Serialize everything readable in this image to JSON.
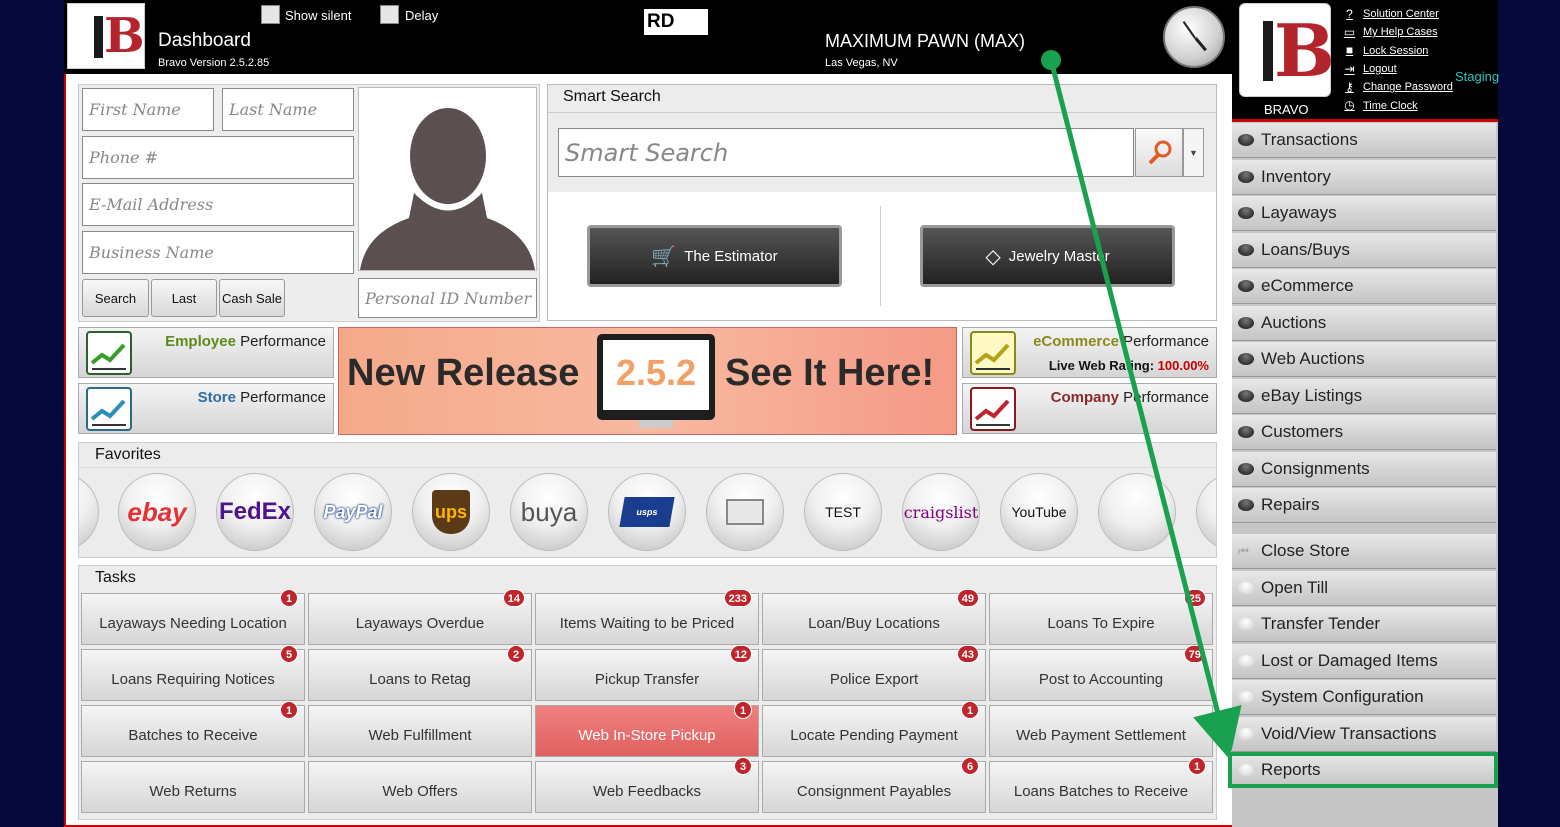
{
  "topbar": {
    "title": "Dashboard",
    "version": "Bravo Version 2.5.2.85",
    "show_silent_label": "Show silent",
    "delay_label": "Delay",
    "rd_code": "RD",
    "store_name": "MAXIMUM PAWN (MAX)",
    "store_location": "Las Vegas, NV"
  },
  "user_panel": {
    "brand": "BRAVO",
    "staging": "Staging",
    "links": [
      {
        "label": "Solution Center",
        "icon": "help-circle-icon"
      },
      {
        "label": "My Help Cases",
        "icon": "folder-icon"
      },
      {
        "label": "Lock Session",
        "icon": "lock-icon"
      },
      {
        "label": "Logout",
        "icon": "logout-icon"
      },
      {
        "label": "Change Password",
        "icon": "key-icon"
      },
      {
        "label": "Time Clock",
        "icon": "clock-icon"
      }
    ]
  },
  "customer_form": {
    "first_name": "First Name",
    "last_name": "Last Name",
    "phone": "Phone #",
    "email": "E-Mail Address",
    "business": "Business Name",
    "personal_id": "Personal ID Number",
    "search_btn": "Search",
    "last_btn": "Last",
    "cash_sale_btn": "Cash Sale"
  },
  "smart_search": {
    "title": "Smart Search",
    "placeholder": "Smart Search",
    "estimator": "The Estimator",
    "jewelry": "Jewelry Master"
  },
  "performance": {
    "employee_hl": "Employee",
    "employee_rest": " Performance",
    "store_hl": "Store",
    "store_rest": " Performance",
    "ecommerce_hl": "eCommerce",
    "ecommerce_rest": " Performance",
    "web_rating_label": "Live Web Rating:",
    "web_rating_value": "100.00%",
    "company_hl": "Company",
    "company_rest": " Performance"
  },
  "banner": {
    "left": "New Release",
    "version": "2.5.2",
    "right": "See It Here!"
  },
  "favorites": {
    "title": "Favorites",
    "items": [
      "ebay",
      "FedEx",
      "PayPal",
      "ups",
      "buya",
      "usps",
      "mail",
      "TEST",
      "craigslist",
      "YouTube",
      "",
      ""
    ]
  },
  "tasks": {
    "title": "Tasks",
    "items": [
      {
        "label": "Layaways Needing Location",
        "badge": "1"
      },
      {
        "label": "Layaways Overdue",
        "badge": "14"
      },
      {
        "label": "Items Waiting to be Priced",
        "badge": "233"
      },
      {
        "label": "Loan/Buy Locations",
        "badge": "49"
      },
      {
        "label": "Loans To Expire",
        "badge": "25"
      },
      {
        "label": "Loans Requiring Notices",
        "badge": "5"
      },
      {
        "label": "Loans to Retag",
        "badge": "2"
      },
      {
        "label": "Pickup Transfer",
        "badge": "12"
      },
      {
        "label": "Police Export",
        "badge": "43"
      },
      {
        "label": "Post to Accounting",
        "badge": "79"
      },
      {
        "label": "Batches to Receive",
        "badge": "1"
      },
      {
        "label": "Web Fulfillment",
        "badge": ""
      },
      {
        "label": "Web In-Store Pickup",
        "badge": "1"
      },
      {
        "label": "Locate Pending Payment",
        "badge": "1"
      },
      {
        "label": "Web Payment Settlement",
        "badge": ""
      },
      {
        "label": "Web Returns",
        "badge": ""
      },
      {
        "label": "Web Offers",
        "badge": ""
      },
      {
        "label": "Web Feedbacks",
        "badge": "3"
      },
      {
        "label": "Consignment Payables",
        "badge": "6"
      },
      {
        "label": "Loans Batches to Receive",
        "badge": "1"
      }
    ]
  },
  "side_menu": [
    "Transactions",
    "Inventory",
    "Layaways",
    "Loans/Buys",
    "eCommerce",
    "Auctions",
    "Web Auctions",
    "eBay Listings",
    "Customers",
    "Consignments",
    "Repairs",
    "Close Store",
    "Open Till",
    "Transfer Tender",
    "Lost or Damaged Items",
    "System Configuration",
    "Void/View Transactions",
    "Reports"
  ],
  "colors": {
    "accent_red": "#c00000",
    "highlight_green": "#1aa150",
    "badge_red": "#c0252b"
  }
}
